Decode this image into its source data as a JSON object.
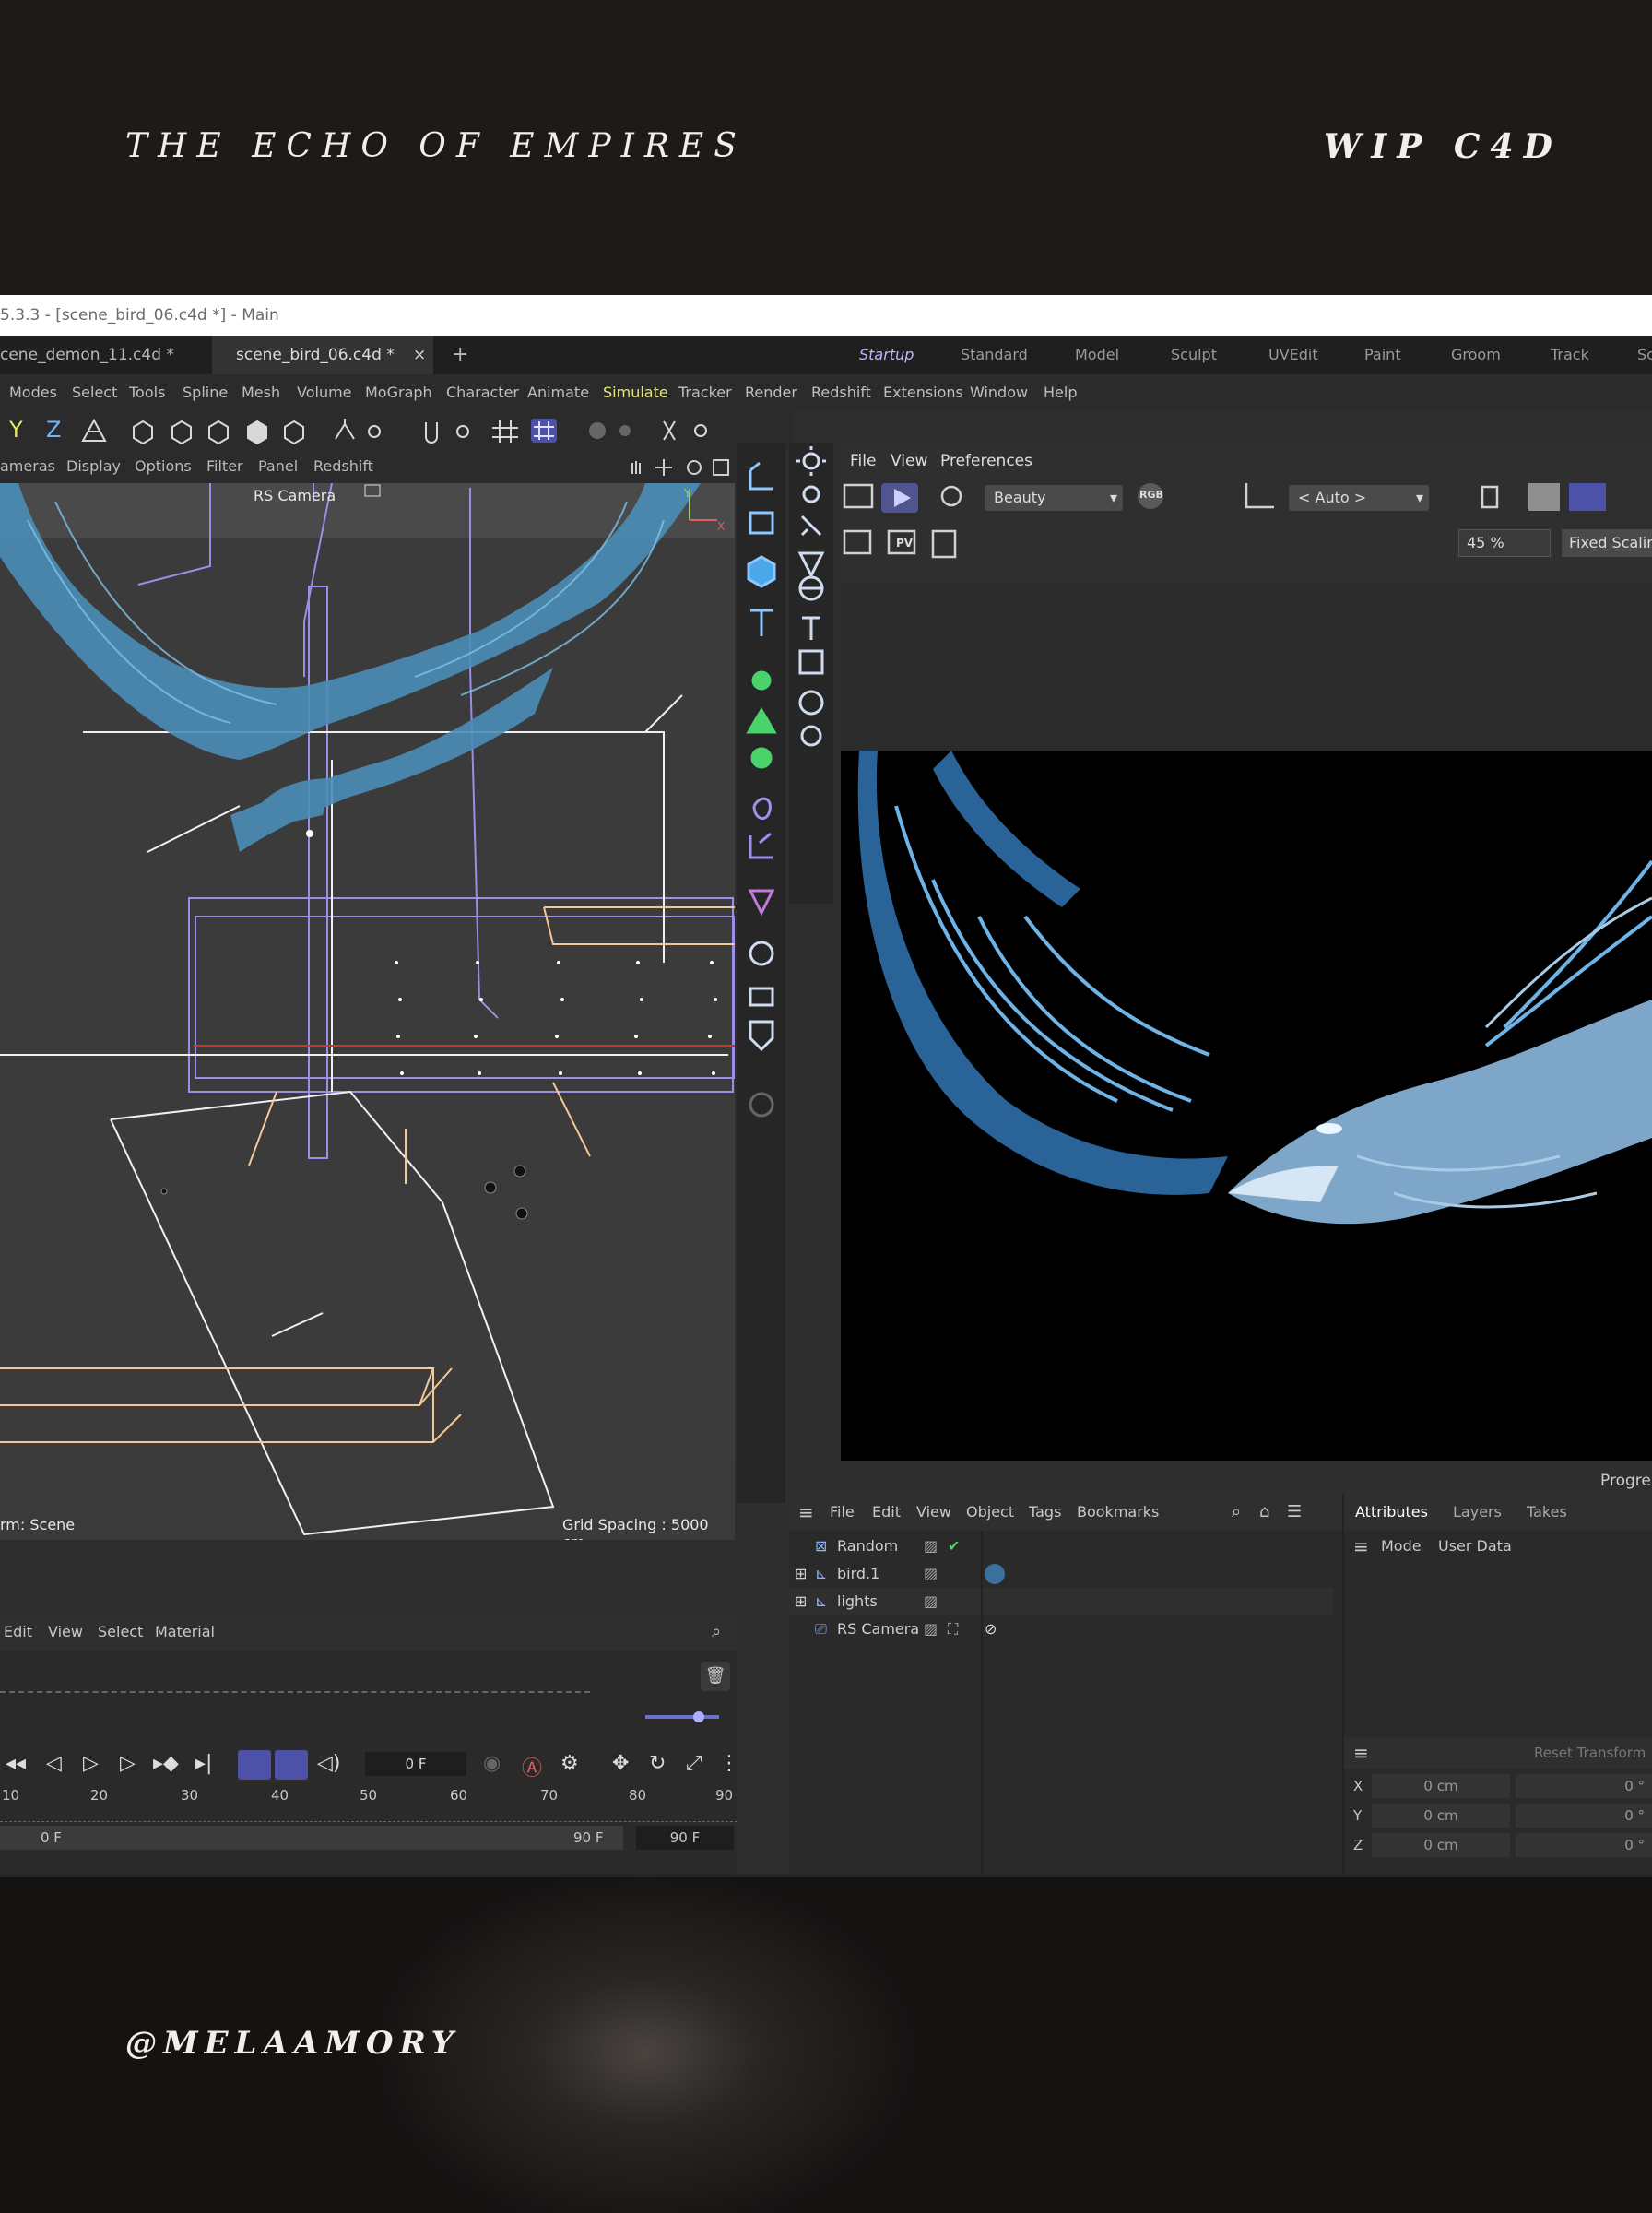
{
  "header": {
    "title": "THE ECHO OF EMPIRES",
    "tag": "WIP C4D"
  },
  "footer": {
    "handle": "@MELAAMORY"
  },
  "app": {
    "window_title": "5.3.3 - [scene_bird_06.c4d *] - Main",
    "file_tabs": [
      "cene_demon_11.c4d *",
      "scene_bird_06.c4d *"
    ],
    "close_glyph": "×",
    "add_tab_glyph": "+",
    "layouts": [
      "Startup",
      "Standard",
      "Model",
      "Sculpt",
      "UVEdit",
      "Paint",
      "Groom",
      "Track",
      "Sc"
    ],
    "menus": [
      "Modes",
      "Select",
      "Tools",
      "Spline",
      "Mesh",
      "Volume",
      "MoGraph",
      "Character",
      "Animate",
      "Simulate",
      "Tracker",
      "Render",
      "Redshift",
      "Extensions",
      "Window",
      "Help"
    ],
    "axis_letters": [
      "Y",
      "Z"
    ],
    "viewport_menu": [
      "ameras",
      "Display",
      "Options",
      "Filter",
      "Panel",
      "Redshift"
    ],
    "camera_label": "RS Camera",
    "axis_y": "Y",
    "axis_x": "X",
    "transform_label": "rm: Scene",
    "grid_spacing": "Grid Spacing : 5000 cm"
  },
  "render_view": {
    "menu": [
      "File",
      "View",
      "Preferences"
    ],
    "aov": "Beauty",
    "camera_mode": "< Auto >",
    "zoom": "45 %",
    "scaling": "Fixed Scalin",
    "progress_label": "Progre",
    "rgb_badge": "RGB",
    "pv_badge": "PV"
  },
  "object_manager": {
    "menu": [
      "File",
      "Edit",
      "View",
      "Object",
      "Tags",
      "Bookmarks"
    ],
    "objects": [
      {
        "name": "Random"
      },
      {
        "name": "bird.1"
      },
      {
        "name": "lights"
      },
      {
        "name": "RS Camera"
      }
    ]
  },
  "attributes": {
    "tabs": [
      "Attributes",
      "Layers",
      "Takes"
    ],
    "mode_items": [
      "Mode",
      "User Data"
    ],
    "reset": "Reset Transform",
    "rows": [
      {
        "axis": "X",
        "pos": "0 cm",
        "rot": "0 °"
      },
      {
        "axis": "Y",
        "pos": "0 cm",
        "rot": "0 °"
      },
      {
        "axis": "Z",
        "pos": "0 cm",
        "rot": "0 °"
      }
    ]
  },
  "material_manager": {
    "menu": [
      "Edit",
      "View",
      "Select",
      "Material"
    ]
  },
  "timeline": {
    "current_frame": "0 F",
    "ruler": [
      "10",
      "20",
      "30",
      "40",
      "50",
      "60",
      "70",
      "80",
      "90"
    ],
    "range_start": "0 F",
    "range_end": "90 F",
    "range_max": "90 F"
  }
}
